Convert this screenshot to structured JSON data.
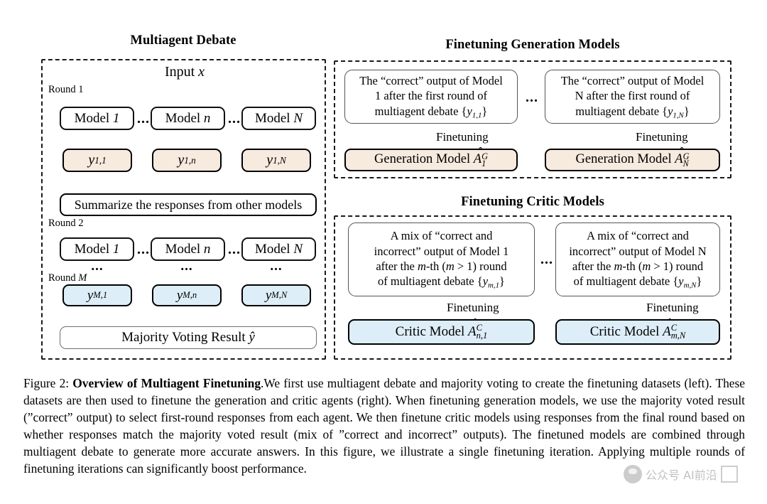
{
  "figure": {
    "panels": {
      "debate": {
        "title": "Multiagent Debate",
        "input_label": "Input",
        "input_var": "x",
        "round1_label": "Round 1",
        "round2_label": "Round 2",
        "roundM_label": "Round",
        "roundM_var": "M",
        "models_round1": [
          {
            "name": "Model",
            "index": "1"
          },
          {
            "name": "Model",
            "index": "n"
          },
          {
            "name": "Model",
            "index": "N"
          }
        ],
        "models_round2": [
          {
            "name": "Model",
            "index": "1"
          },
          {
            "name": "Model",
            "index": "n"
          },
          {
            "name": "Model",
            "index": "N"
          }
        ],
        "outputs_round1": [
          {
            "var": "y",
            "sub": "1,1"
          },
          {
            "var": "y",
            "sub": "1,n"
          },
          {
            "var": "y",
            "sub": "1,N"
          }
        ],
        "outputs_roundM": [
          {
            "var": "y",
            "sub": "M,1"
          },
          {
            "var": "y",
            "sub": "M,n"
          },
          {
            "var": "y",
            "sub": "M,N"
          }
        ],
        "summarize_label": "Summarize the responses from other models",
        "majority_label": "Majority Voting Result",
        "majority_var": "ŷ",
        "ellipsis": "...",
        "vertical_ellipsis": "..."
      },
      "generation": {
        "title": "Finetuning Generation Models",
        "ellipsis": "...",
        "arrow_label": "Finetuning",
        "sources": [
          {
            "line1": "The “correct” output of Model",
            "line2": "1 after the first round of",
            "line3_pre": "multiagent debate {",
            "line3_var": "y",
            "line3_sub": "1,1",
            "line3_post": "}"
          },
          {
            "line1": "The “correct” output of Model",
            "line2": "N after the first round of",
            "line3_pre": "multiagent debate {",
            "line3_var": "y",
            "line3_sub": "1,N",
            "line3_post": "}"
          }
        ],
        "targets": [
          {
            "label": "Generation Model",
            "var": "A",
            "sup": "G",
            "sub": "1"
          },
          {
            "label": "Generation Model",
            "var": "A",
            "sup": "G",
            "sub": "N"
          }
        ]
      },
      "critic": {
        "title": "Finetuning Critic Models",
        "ellipsis": "...",
        "arrow_label": "Finetuning",
        "sources": [
          {
            "line1": "A mix of “correct and",
            "line2": "incorrect” output of Model 1",
            "line3_pre": "after the ",
            "line3_m": "m",
            "line3_mid": "-th (",
            "line3_m2": "m",
            "line3_post": " > 1) round",
            "line4_pre": "of multiagent debate {",
            "line4_var": "y",
            "line4_sub": "m,1",
            "line4_post": "}"
          },
          {
            "line1": "A mix of “correct and",
            "line2": "incorrect” output of Model N",
            "line3_pre": "after the ",
            "line3_m": "m",
            "line3_mid": "-th (",
            "line3_m2": "m",
            "line3_post": " > 1) round",
            "line4_pre": "of multiagent debate {",
            "line4_var": "y",
            "line4_sub": "m,N",
            "line4_post": "}"
          }
        ],
        "targets": [
          {
            "label": "Critic Model",
            "var": "A",
            "sup": "C",
            "sub": "n,1"
          },
          {
            "label": "Critic Model",
            "var": "A",
            "sup": "C",
            "sub": "m,N"
          }
        ]
      }
    },
    "colors": {
      "peach": "#f7eade",
      "blue": "#ddeef8",
      "stroke": "#111111",
      "dashed": "#1a1a1a",
      "grey_stroke": "#6e6e6e"
    }
  },
  "caption": {
    "prefix": "Figure 2: ",
    "bold_title": "Overview of Multiagent Finetuning",
    "body": ".We first use multiagent debate and majority voting to create the finetuning datasets (left). These datasets are then used to finetune the generation and critic agents (right). When finetuning generation models, we use the majority voted result (”correct” output) to select first-round responses from each agent. We then finetune critic models using responses from the final round based on whether responses match the majority voted result (mix of ”correct and incorrect” outputs). The finetuned models are combined through multiagent debate to generate more accurate answers. In this figure, we illustrate a single finetuning iteration. Applying multiple rounds of finetuning iterations can significantly boost performance."
  },
  "watermark": {
    "text": "公众号 AI前沿"
  }
}
